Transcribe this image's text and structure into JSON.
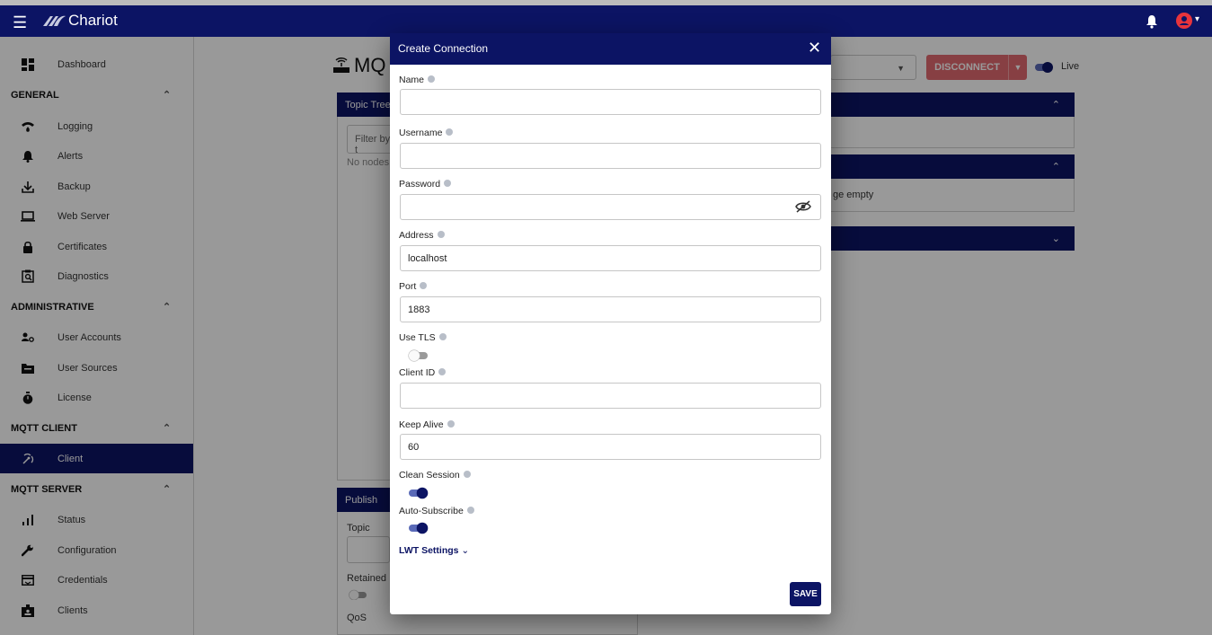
{
  "app": {
    "brand": "Chariot"
  },
  "sidebar": {
    "items": [
      {
        "label": "Dashboard",
        "icon": "dashboard-icon"
      },
      {
        "label": "Logging",
        "icon": "wifi-icon"
      },
      {
        "label": "Alerts",
        "icon": "bell-icon"
      },
      {
        "label": "Backup",
        "icon": "download-icon"
      },
      {
        "label": "Web Server",
        "icon": "laptop-icon"
      },
      {
        "label": "Certificates",
        "icon": "lock-icon"
      },
      {
        "label": "Diagnostics",
        "icon": "clipboard-search-icon"
      },
      {
        "label": "User Accounts",
        "icon": "users-gear-icon"
      },
      {
        "label": "User Sources",
        "icon": "folder-icon"
      },
      {
        "label": "License",
        "icon": "stopwatch-icon"
      },
      {
        "label": "Client",
        "icon": "antenna-icon"
      },
      {
        "label": "Status",
        "icon": "bar-chart-icon"
      },
      {
        "label": "Configuration",
        "icon": "wrench-icon"
      },
      {
        "label": "Credentials",
        "icon": "credit-card-icon"
      },
      {
        "label": "Clients",
        "icon": "badge-icon"
      }
    ],
    "sections": {
      "general": "GENERAL",
      "administrative": "ADMINISTRATIVE",
      "mqtt_client": "MQTT CLIENT",
      "mqtt_server": "MQTT SERVER"
    }
  },
  "background": {
    "page_title": "MQ",
    "topic_tree": "Topic Tree",
    "filter_placeholder": "Filter by t",
    "no_nodes": "No nodes a",
    "publish": "Publish",
    "topic_label": "Topic",
    "retained_label": "Retained",
    "qos_label": "QoS",
    "disconnect": "DISCONNECT",
    "live": "Live",
    "panel2_text": "ge empty"
  },
  "modal": {
    "title": "Create Connection",
    "fields": {
      "name": {
        "label": "Name",
        "value": ""
      },
      "username": {
        "label": "Username",
        "value": ""
      },
      "password": {
        "label": "Password",
        "value": ""
      },
      "address": {
        "label": "Address",
        "value": "localhost"
      },
      "port": {
        "label": "Port",
        "value": "1883"
      },
      "use_tls": {
        "label": "Use TLS",
        "on": false
      },
      "client_id": {
        "label": "Client ID",
        "value": ""
      },
      "keep_alive": {
        "label": "Keep Alive",
        "value": "60"
      },
      "clean_session": {
        "label": "Clean Session",
        "on": true
      },
      "auto_subscribe": {
        "label": "Auto-Subscribe",
        "on": true
      }
    },
    "lwt": "LWT Settings",
    "save": "SAVE"
  },
  "colors": {
    "primary": "#0c1464",
    "danger": "#e26a70"
  }
}
